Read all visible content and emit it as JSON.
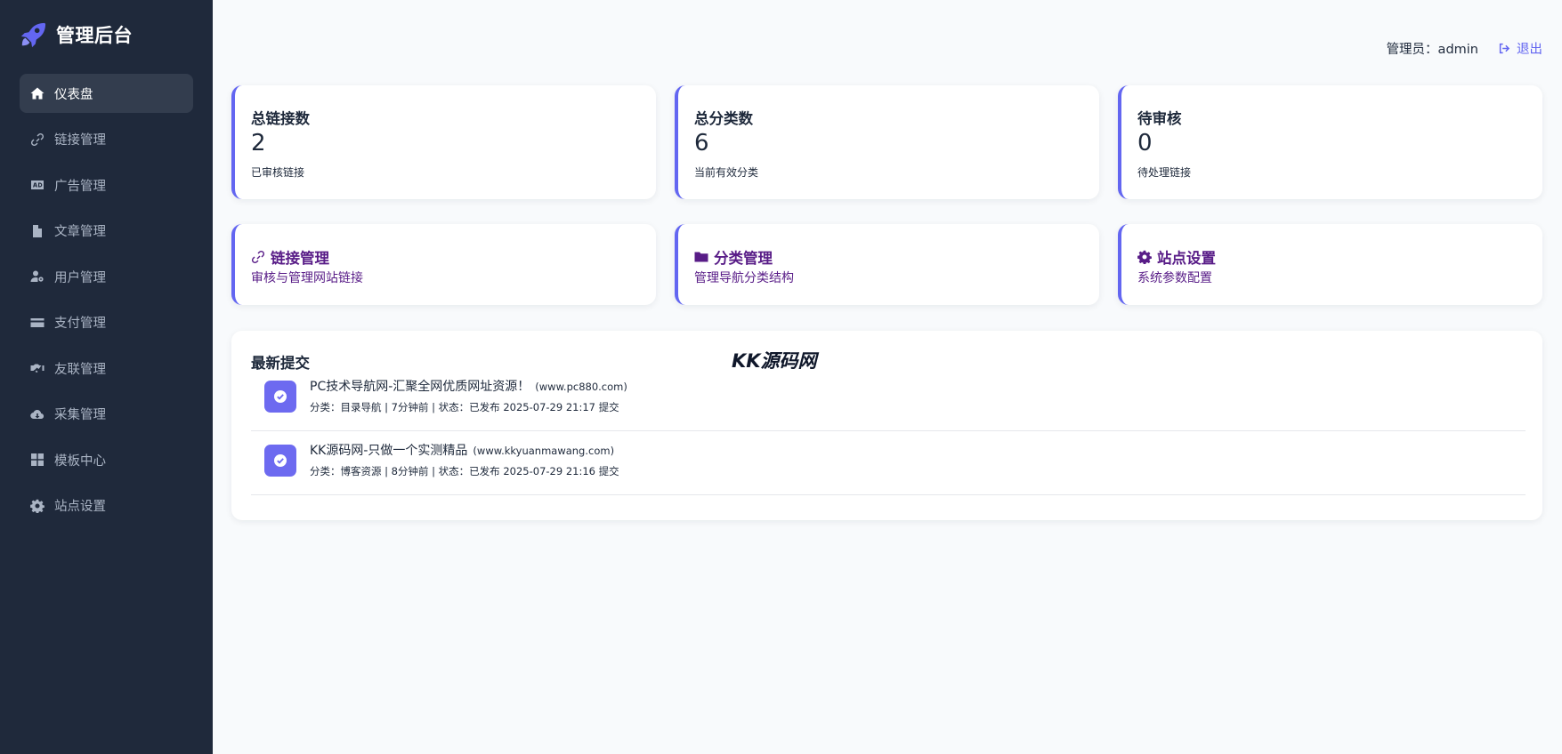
{
  "brand": {
    "title": "管理后台",
    "icon": "rocket-icon"
  },
  "sidebar": {
    "items": [
      {
        "label": "仪表盘",
        "icon": "home-icon",
        "active": true
      },
      {
        "label": "链接管理",
        "icon": "link-icon"
      },
      {
        "label": "广告管理",
        "icon": "ad-icon"
      },
      {
        "label": "文章管理",
        "icon": "file-icon"
      },
      {
        "label": "用户管理",
        "icon": "user-gear-icon"
      },
      {
        "label": "支付管理",
        "icon": "credit-card-icon"
      },
      {
        "label": "友联管理",
        "icon": "handshake-icon"
      },
      {
        "label": "采集管理",
        "icon": "cloud-download-icon"
      },
      {
        "label": "模板中心",
        "icon": "grid-icon"
      },
      {
        "label": "站点设置",
        "icon": "gear-icon"
      }
    ]
  },
  "header": {
    "admin_label": "管理员：admin",
    "logout_label": "退出"
  },
  "stats": [
    {
      "title": "总链接数",
      "value": "2",
      "sub": "已审核链接"
    },
    {
      "title": "总分类数",
      "value": "6",
      "sub": "当前有效分类"
    },
    {
      "title": "待审核",
      "value": "0",
      "sub": "待处理链接"
    }
  ],
  "quick_actions": [
    {
      "title": "链接管理",
      "sub": "审核与管理网站链接",
      "icon": "link-icon"
    },
    {
      "title": "分类管理",
      "sub": "管理导航分类结构",
      "icon": "folder-icon"
    },
    {
      "title": "站点设置",
      "sub": "系统参数配置",
      "icon": "gear-icon"
    }
  ],
  "recent": {
    "title": "最新提交",
    "items": [
      {
        "title": "PC技术导航网-汇聚全网优质网址资源！",
        "url": "(www.pc880.com)",
        "meta": "分类：目录导航 | 7分钟前 | 状态：已发布 2025-07-29 21:17 提交"
      },
      {
        "title": "KK源码网-只做一个实测精品",
        "url": "(www.kkyuanmawang.com)",
        "meta": "分类：博客资源 | 8分钟前 | 状态：已发布 2025-07-29 21:16 提交"
      }
    ]
  },
  "watermark": "KK源码网",
  "colors": {
    "sidebar_bg": "#1f293b",
    "accent": "#6366f1",
    "quick_action_text": "#581c87",
    "page_bg": "#f8fafc"
  }
}
